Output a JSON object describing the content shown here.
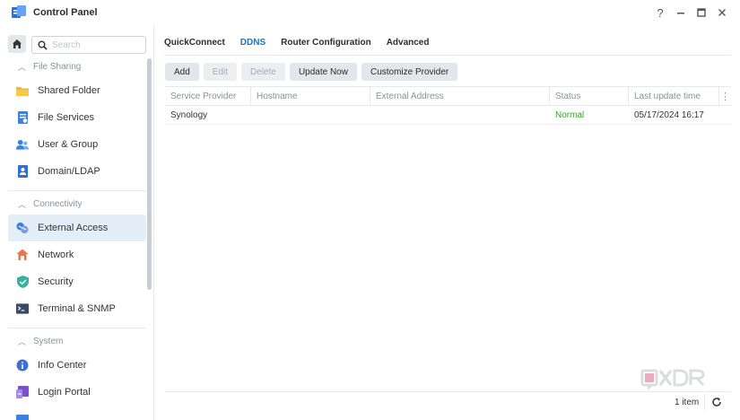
{
  "window": {
    "title": "Control Panel",
    "help_icon": "help-icon",
    "minimize_icon": "minimize-icon",
    "maximize_icon": "maximize-icon",
    "close_icon": "close-icon"
  },
  "sidebar": {
    "search_placeholder": "Search",
    "sections": [
      {
        "label": "File Sharing",
        "items": [
          {
            "label": "Shared Folder",
            "icon": "folder-icon"
          },
          {
            "label": "File Services",
            "icon": "file-services-icon"
          },
          {
            "label": "User & Group",
            "icon": "users-icon"
          },
          {
            "label": "Domain/LDAP",
            "icon": "domain-icon"
          }
        ]
      },
      {
        "label": "Connectivity",
        "items": [
          {
            "label": "External Access",
            "icon": "external-access-icon",
            "active": true
          },
          {
            "label": "Network",
            "icon": "network-icon"
          },
          {
            "label": "Security",
            "icon": "shield-icon"
          },
          {
            "label": "Terminal & SNMP",
            "icon": "terminal-icon"
          }
        ]
      },
      {
        "label": "System",
        "items": [
          {
            "label": "Info Center",
            "icon": "info-icon"
          },
          {
            "label": "Login Portal",
            "icon": "login-portal-icon"
          }
        ]
      }
    ]
  },
  "tabs": [
    {
      "label": "QuickConnect",
      "active": false
    },
    {
      "label": "DDNS",
      "active": true
    },
    {
      "label": "Router Configuration",
      "active": false
    },
    {
      "label": "Advanced",
      "active": false
    }
  ],
  "toolbar": {
    "add": "Add",
    "edit": "Edit",
    "delete": "Delete",
    "update_now": "Update Now",
    "customize_provider": "Customize Provider"
  },
  "table": {
    "columns": [
      "Service Provider",
      "Hostname",
      "External Address",
      "Status",
      "Last update time"
    ],
    "rows": [
      {
        "provider": "Synology",
        "hostname": "",
        "external_address": "",
        "status": "Normal",
        "last_update": "05/17/2024 16:17"
      }
    ]
  },
  "footer": {
    "count": "1 item"
  },
  "colors": {
    "accent": "#1a73c8",
    "status_normal": "#35a32d",
    "active_bg": "#e3eef9"
  }
}
